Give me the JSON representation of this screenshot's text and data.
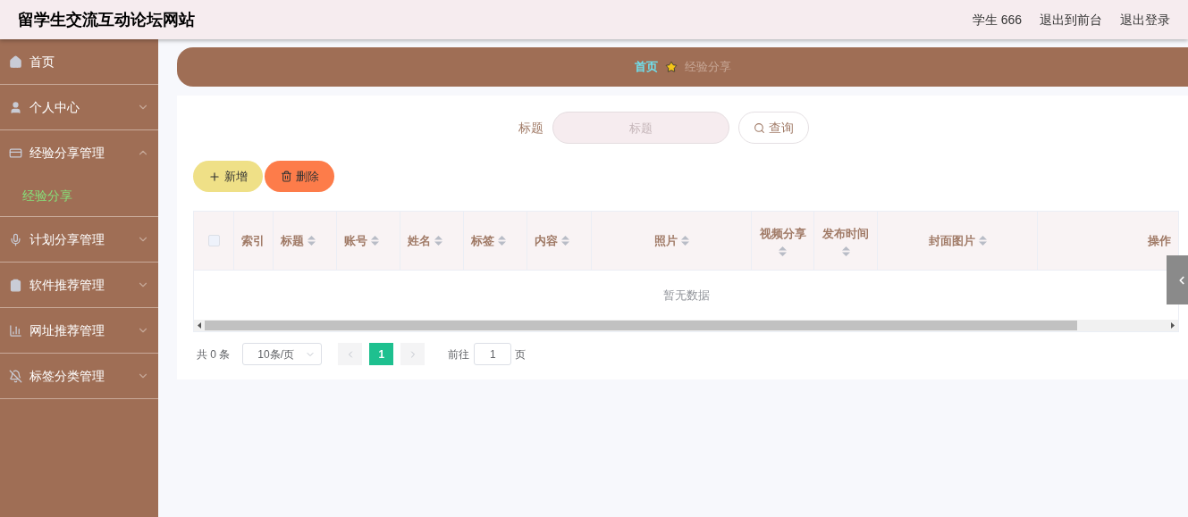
{
  "header": {
    "title": "留学生交流互动论坛网站",
    "user": "学生 666",
    "links": [
      "退出到前台",
      "退出登录"
    ]
  },
  "sidebar": {
    "items": [
      {
        "label": "首页"
      },
      {
        "label": "个人中心",
        "expanded": false
      },
      {
        "label": "经验分享管理",
        "expanded": true,
        "children": [
          {
            "label": "经验分享",
            "selected": true
          }
        ]
      },
      {
        "label": "计划分享管理",
        "expanded": false
      },
      {
        "label": "软件推荐管理",
        "expanded": false
      },
      {
        "label": "网址推荐管理",
        "expanded": false
      },
      {
        "label": "标签分类管理",
        "expanded": false
      }
    ]
  },
  "breadcrumb": [
    {
      "label": "首页",
      "selected": true
    },
    {
      "label": "经验分享",
      "selected": false
    }
  ],
  "search": {
    "label": "标题",
    "placeholder": "标题",
    "button": "查询"
  },
  "actions": [
    {
      "kind": "add",
      "label": "新增"
    },
    {
      "kind": "delete",
      "label": "删除"
    }
  ],
  "table": {
    "all_checked": false,
    "columns": [
      {
        "label": "索引",
        "sortable": false
      },
      {
        "label": "标题",
        "sortable": true
      },
      {
        "label": "账号",
        "sortable": true
      },
      {
        "label": "姓名",
        "sortable": true
      },
      {
        "label": "标签",
        "sortable": true
      },
      {
        "label": "内容",
        "sortable": true
      },
      {
        "label": "照片",
        "sortable": true
      },
      {
        "label": "视频分享",
        "sortable": true
      },
      {
        "label": "发布时间",
        "sortable": true
      },
      {
        "label": "封面图片",
        "sortable": true
      },
      {
        "label": "操作",
        "sortable": false
      }
    ],
    "empty_text": "暂无数据"
  },
  "pagination": {
    "total": "共 0 条",
    "page_size": "10条/页",
    "pages": [
      {
        "label": "1",
        "selected": true
      }
    ],
    "goto_label": "前往",
    "goto_value": "1",
    "goto_suffix": "页"
  }
}
